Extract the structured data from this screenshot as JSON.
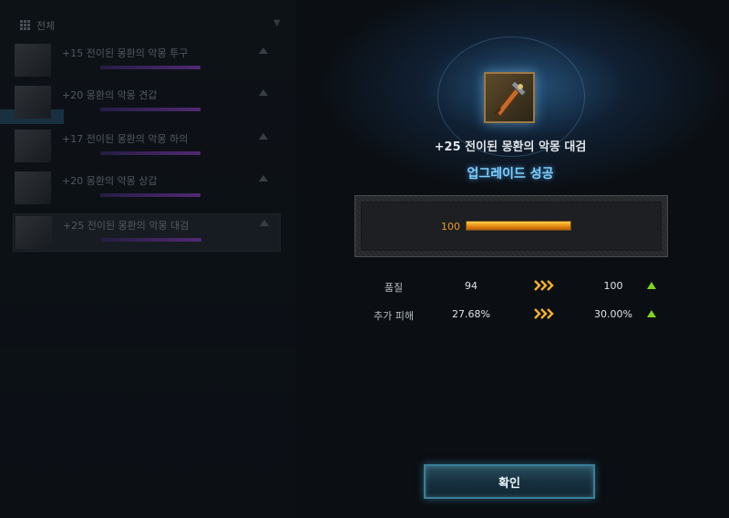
{
  "left_panel": {
    "filter_label": "전체",
    "items": [
      {
        "name": "+15 전이된 몽환의 악몽 투구"
      },
      {
        "name": "+20 몽환의 악몽 견갑"
      },
      {
        "name": "+17 전이된 몽환의 악몽 하의"
      },
      {
        "name": "+20 몽환의 악몽 상갑"
      },
      {
        "name": "+25 전이된 몽환의 악몽 대검"
      }
    ]
  },
  "result": {
    "item_name": "+25 전이된 몽환의 악몽 대검",
    "icon": "greatsword-icon",
    "status": "업그레이드 성공",
    "quality_bar": {
      "value_label": "100",
      "fill_fraction": 1.0
    }
  },
  "stats": [
    {
      "label": "품질",
      "before": "94",
      "after": "100",
      "icon": "chevron-right-icon"
    },
    {
      "label": "추가 피해",
      "before": "27.68%",
      "after": "30.00%",
      "icon": "chevron-right-icon"
    }
  ],
  "buttons": {
    "confirm_label": "확인"
  },
  "colors": {
    "accent_blue": "#7fd0ff",
    "bar_orange": "#e58a12",
    "increase_green": "#7ed321",
    "chevron_gold": "#f0b030"
  }
}
